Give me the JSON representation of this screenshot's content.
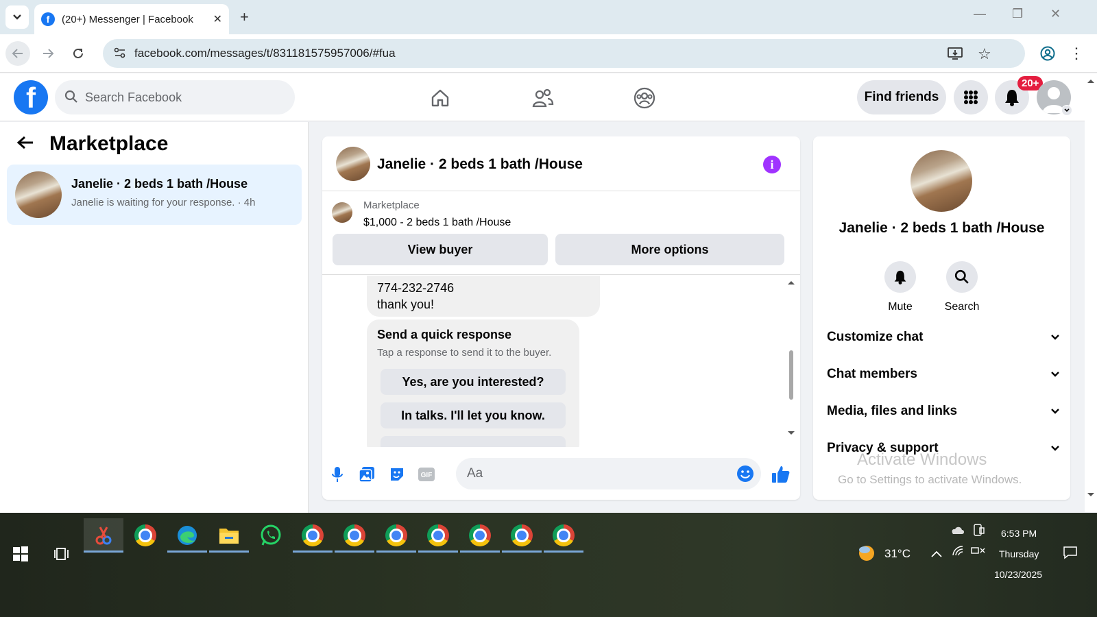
{
  "browser": {
    "tab_title": "(20+) Messenger | Facebook",
    "url": "facebook.com/messages/t/831181575957006/#fua"
  },
  "facebook": {
    "search_placeholder": "Search Facebook",
    "find_friends": "Find friends",
    "notif_badge": "20+"
  },
  "sidebar": {
    "title": "Marketplace",
    "conversation": {
      "name": "Janelie · 2 beds 1 bath /House",
      "preview": "Janelie is waiting for your response. · 4h"
    }
  },
  "chat": {
    "title": "Janelie · 2 beds 1 bath /House",
    "marketplace_label": "Marketplace",
    "listing": "$1,000 - 2 beds 1 bath /House",
    "view_buyer": "View buyer",
    "more_options": "More options",
    "message_line1": "774-232-2746",
    "message_line2": "thank you!",
    "quick_title": "Send a quick response",
    "quick_subtitle": "Tap a response to send it to the buyer.",
    "quick_replies": [
      "Yes, are you interested?",
      "In talks. I'll let you know."
    ],
    "composer_placeholder": "Aa"
  },
  "details": {
    "name": "Janelie · 2 beds 1 bath /House",
    "mute": "Mute",
    "search": "Search",
    "sections": [
      "Customize chat",
      "Chat members",
      "Media, files and links",
      "Privacy & support"
    ]
  },
  "watermark": {
    "line1": "Activate Windows",
    "line2": "Go to Settings to activate Windows."
  },
  "taskbar": {
    "temperature": "31°C",
    "time": "6:53 PM",
    "day": "Thursday",
    "date": "10/23/2025"
  },
  "colors": {
    "fb_blue": "#1877f2",
    "info_purple": "#a033ff",
    "badge_red": "#e41e3f"
  }
}
